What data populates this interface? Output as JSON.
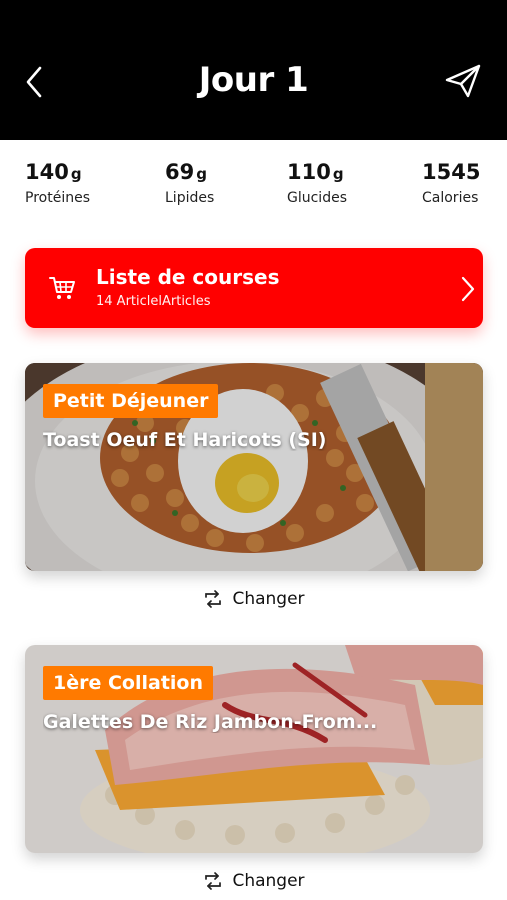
{
  "header": {
    "title": "Jour 1",
    "back_icon": "chevron-left-icon",
    "share_icon": "paper-plane-icon"
  },
  "macros": [
    {
      "value": "140",
      "unit": "g",
      "label": "Protéines"
    },
    {
      "value": "69",
      "unit": "g",
      "label": "Lipides"
    },
    {
      "value": "110",
      "unit": "g",
      "label": "Glucides"
    },
    {
      "value": "1545",
      "unit": "",
      "label": "Calories"
    }
  ],
  "shopping": {
    "title": "Liste de courses",
    "subtitle": "14 ArticlelArticles",
    "accent": "#ff0000"
  },
  "meals": [
    {
      "tag": "Petit Déjeuner",
      "name": "Toast Oeuf Et Haricots (SI)",
      "change_label": "Changer"
    },
    {
      "tag": "1ère Collation",
      "name": "Galettes De Riz Jambon-From...",
      "change_label": "Changer"
    }
  ],
  "colors": {
    "header_bg": "#000000",
    "tag_bg": "#ff7a00"
  }
}
